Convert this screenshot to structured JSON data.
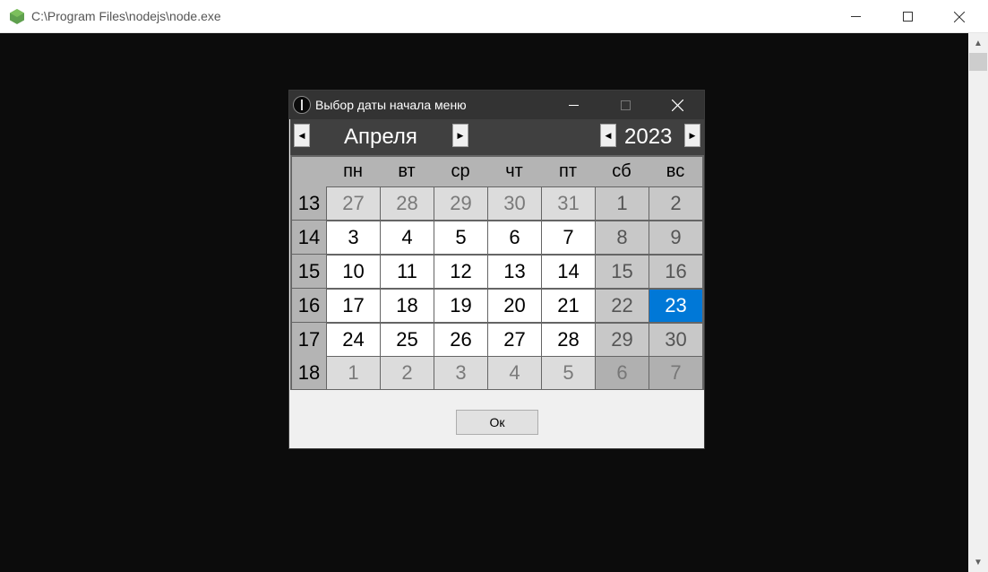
{
  "window": {
    "title": "C:\\Program Files\\nodejs\\node.exe",
    "icon": "nodejs-icon"
  },
  "dialog": {
    "title": "Выбор даты начала меню",
    "month": "Апреля",
    "year": "2023",
    "ok_label": "Ок"
  },
  "calendar": {
    "weekdays": [
      "пн",
      "вт",
      "ср",
      "чт",
      "пт",
      "сб",
      "вс"
    ],
    "weeks": [
      {
        "num": "13",
        "days": [
          "27",
          "28",
          "29",
          "30",
          "31",
          "1",
          "2"
        ]
      },
      {
        "num": "14",
        "days": [
          "3",
          "4",
          "5",
          "6",
          "7",
          "8",
          "9"
        ]
      },
      {
        "num": "15",
        "days": [
          "10",
          "11",
          "12",
          "13",
          "14",
          "15",
          "16"
        ]
      },
      {
        "num": "16",
        "days": [
          "17",
          "18",
          "19",
          "20",
          "21",
          "22",
          "23"
        ]
      },
      {
        "num": "17",
        "days": [
          "24",
          "25",
          "26",
          "27",
          "28",
          "29",
          "30"
        ]
      },
      {
        "num": "18",
        "days": [
          "1",
          "2",
          "3",
          "4",
          "5",
          "6",
          "7"
        ]
      }
    ],
    "selected_day": "23",
    "selected_color": "#0078d7"
  }
}
